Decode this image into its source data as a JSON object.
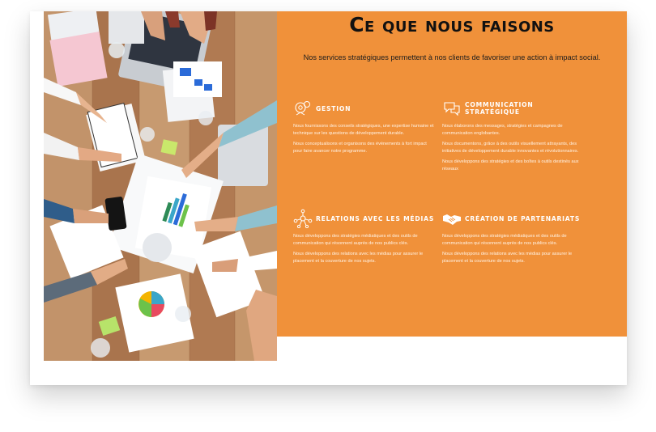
{
  "section": {
    "title": "Ce que nous faisons",
    "subtitle": "Nos services stratégiques permettent à nos clients de favoriser une action à impact social."
  },
  "services": [
    {
      "icon": "strategy-gears-icon",
      "title": "Gestion",
      "paragraphs": [
        "Nous fournissons des conseils stratégiques, une expertise humaine et technique sur les questions de développement durable.",
        "Nous conceptualisons et organisons des événements à fort impact pour faire avancer notre programme."
      ]
    },
    {
      "icon": "speech-bubbles-icon",
      "title": "Communication stratégique",
      "paragraphs": [
        "Nous élaborons des messages, stratégies et campagnes de communication englobantes.",
        "Nous documentons, grâce à des outils visuellement attrayants, des initiatives de développement durable innovantes et révolutionnaires.",
        "Nous développons des stratégies et des boîtes à outils destinés aux réseaux"
      ]
    },
    {
      "icon": "network-nodes-icon",
      "title": "Relations avec les médias",
      "paragraphs": [
        "Nous développons des stratégies médiatiques et des outils de communication qui résonnent auprès de nos publics clés.",
        "Nous développons des relations avec les médias pour assurer le placement et la couverture de nos sujets."
      ]
    },
    {
      "icon": "handshake-icon",
      "title": "Création de partenariats",
      "paragraphs": [
        "Nous développons des stratégies médiatiques et des outils de communication qui résonnent auprès de nos publics clés.",
        "Nous développons des relations avec les médias pour assurer le placement et la couverture de nos sujets."
      ]
    }
  ],
  "colors": {
    "accent": "#f0913a",
    "title": "#111111",
    "text": "#ffffff"
  },
  "photo": {
    "subject": "team-meeting-table-photo"
  }
}
